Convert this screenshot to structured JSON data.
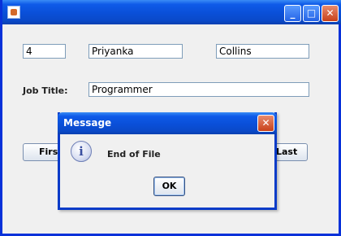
{
  "window": {
    "title_buttons": {
      "minimize": "_",
      "maximize": "□",
      "close": "✕"
    }
  },
  "form": {
    "id_value": "4",
    "first_name_value": "Priyanka",
    "last_name_value": "Collins",
    "job_title_label": "Job Title:",
    "job_title_value": "Programmer"
  },
  "nav": {
    "first_label": "First",
    "last_label": "Last"
  },
  "dialog": {
    "title": "Message",
    "message": "End of File",
    "ok_label": "OK",
    "icon": "info-icon",
    "close_glyph": "✕"
  }
}
